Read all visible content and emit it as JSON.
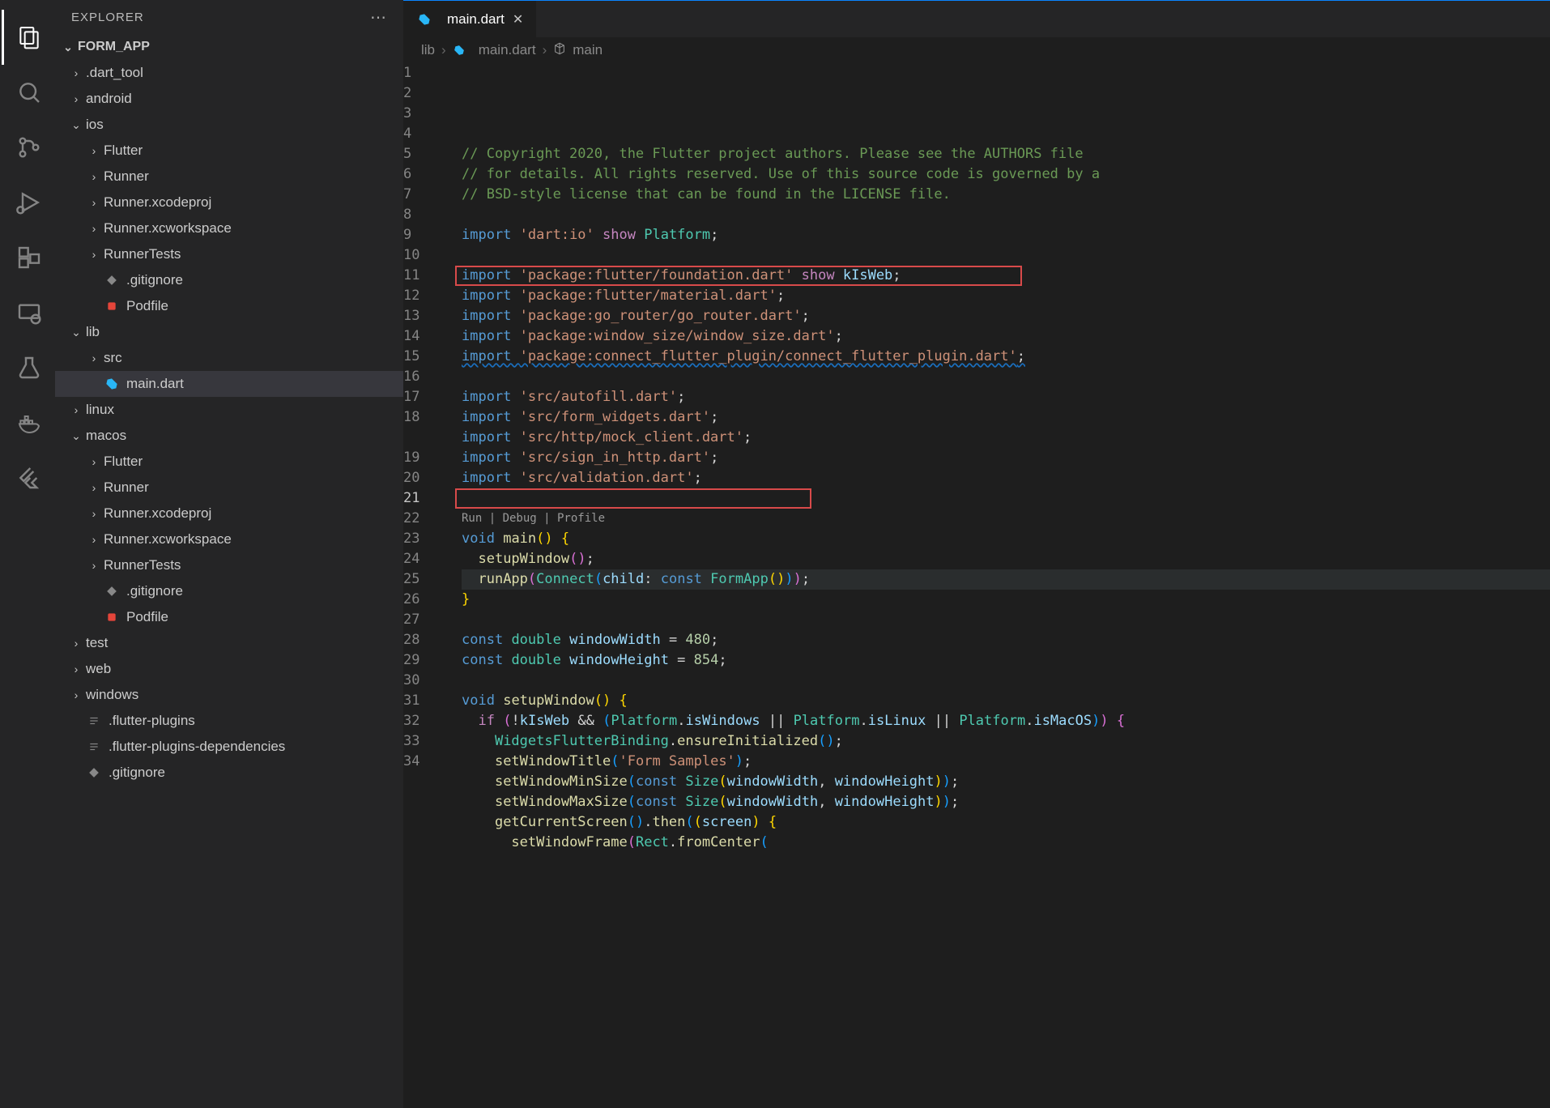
{
  "explorer_title": "EXPLORER",
  "project_name": "FORM_APP",
  "tab": {
    "label": "main.dart"
  },
  "breadcrumbs": {
    "folder": "lib",
    "file": "main.dart",
    "symbol": "main"
  },
  "codelens": "Run | Debug | Profile",
  "tree": [
    {
      "depth": 0,
      "chev": "›",
      "icon": "folder",
      "label": ".dart_tool"
    },
    {
      "depth": 0,
      "chev": "›",
      "icon": "folder",
      "label": "android"
    },
    {
      "depth": 0,
      "chev": "⌄",
      "icon": "folder",
      "label": "ios"
    },
    {
      "depth": 1,
      "chev": "›",
      "icon": "folder",
      "label": "Flutter"
    },
    {
      "depth": 1,
      "chev": "›",
      "icon": "folder",
      "label": "Runner"
    },
    {
      "depth": 1,
      "chev": "›",
      "icon": "folder",
      "label": "Runner.xcodeproj"
    },
    {
      "depth": 1,
      "chev": "›",
      "icon": "folder",
      "label": "Runner.xcworkspace"
    },
    {
      "depth": 1,
      "chev": "›",
      "icon": "folder",
      "label": "RunnerTests"
    },
    {
      "depth": 1,
      "chev": "",
      "icon": "git",
      "label": ".gitignore"
    },
    {
      "depth": 1,
      "chev": "",
      "icon": "pod",
      "label": "Podfile"
    },
    {
      "depth": 0,
      "chev": "⌄",
      "icon": "folder",
      "label": "lib"
    },
    {
      "depth": 1,
      "chev": "›",
      "icon": "folder",
      "label": "src"
    },
    {
      "depth": 1,
      "chev": "",
      "icon": "dart",
      "label": "main.dart",
      "active": true
    },
    {
      "depth": 0,
      "chev": "›",
      "icon": "folder",
      "label": "linux"
    },
    {
      "depth": 0,
      "chev": "⌄",
      "icon": "folder",
      "label": "macos"
    },
    {
      "depth": 1,
      "chev": "›",
      "icon": "folder",
      "label": "Flutter"
    },
    {
      "depth": 1,
      "chev": "›",
      "icon": "folder",
      "label": "Runner"
    },
    {
      "depth": 1,
      "chev": "›",
      "icon": "folder",
      "label": "Runner.xcodeproj"
    },
    {
      "depth": 1,
      "chev": "›",
      "icon": "folder",
      "label": "Runner.xcworkspace"
    },
    {
      "depth": 1,
      "chev": "›",
      "icon": "folder",
      "label": "RunnerTests"
    },
    {
      "depth": 1,
      "chev": "",
      "icon": "git",
      "label": ".gitignore"
    },
    {
      "depth": 1,
      "chev": "",
      "icon": "pod",
      "label": "Podfile"
    },
    {
      "depth": 0,
      "chev": "›",
      "icon": "folder",
      "label": "test"
    },
    {
      "depth": 0,
      "chev": "›",
      "icon": "folder",
      "label": "web"
    },
    {
      "depth": 0,
      "chev": "›",
      "icon": "folder",
      "label": "windows"
    },
    {
      "depth": 0,
      "chev": "",
      "icon": "text",
      "label": ".flutter-plugins"
    },
    {
      "depth": 0,
      "chev": "",
      "icon": "text",
      "label": ".flutter-plugins-dependencies"
    },
    {
      "depth": 0,
      "chev": "",
      "icon": "git",
      "label": ".gitignore"
    }
  ],
  "code": {
    "lines": [
      {
        "n": 1,
        "tokens": [
          [
            "comment",
            "// Copyright 2020, the Flutter project authors. Please see the AUTHORS file"
          ]
        ]
      },
      {
        "n": 2,
        "tokens": [
          [
            "comment",
            "// for details. All rights reserved. Use of this source code is governed by a"
          ]
        ]
      },
      {
        "n": 3,
        "tokens": [
          [
            "comment",
            "// BSD-style license that can be found in the LICENSE file."
          ]
        ]
      },
      {
        "n": 4,
        "tokens": []
      },
      {
        "n": 5,
        "tokens": [
          [
            "keyword",
            "import "
          ],
          [
            "string",
            "'dart:io'"
          ],
          [
            "punc",
            " "
          ],
          [
            "show",
            "show"
          ],
          [
            "punc",
            " "
          ],
          [
            "type",
            "Platform"
          ],
          [
            "punc",
            ";"
          ]
        ]
      },
      {
        "n": 6,
        "tokens": []
      },
      {
        "n": 7,
        "tokens": [
          [
            "keyword",
            "import "
          ],
          [
            "string",
            "'package:flutter/foundation.dart'"
          ],
          [
            "punc",
            " "
          ],
          [
            "show",
            "show"
          ],
          [
            "punc",
            " "
          ],
          [
            "ident",
            "kIsWeb"
          ],
          [
            "punc",
            ";"
          ]
        ]
      },
      {
        "n": 8,
        "tokens": [
          [
            "keyword",
            "import "
          ],
          [
            "string",
            "'package:flutter/material.dart'"
          ],
          [
            "punc",
            ";"
          ]
        ]
      },
      {
        "n": 9,
        "tokens": [
          [
            "keyword",
            "import "
          ],
          [
            "string",
            "'package:go_router/go_router.dart'"
          ],
          [
            "punc",
            ";"
          ]
        ]
      },
      {
        "n": 10,
        "tokens": [
          [
            "keyword",
            "import "
          ],
          [
            "string",
            "'package:window_size/window_size.dart'"
          ],
          [
            "punc",
            ";"
          ]
        ]
      },
      {
        "n": 11,
        "wavy": true,
        "tokens": [
          [
            "keyword",
            "import "
          ],
          [
            "string",
            "'package:connect_flutter_plugin/connect_flutter_plugin.dart'"
          ],
          [
            "punc",
            ";"
          ]
        ]
      },
      {
        "n": 12,
        "tokens": []
      },
      {
        "n": 13,
        "tokens": [
          [
            "keyword",
            "import "
          ],
          [
            "string",
            "'src/autofill.dart'"
          ],
          [
            "punc",
            ";"
          ]
        ]
      },
      {
        "n": 14,
        "tokens": [
          [
            "keyword",
            "import "
          ],
          [
            "string",
            "'src/form_widgets.dart'"
          ],
          [
            "punc",
            ";"
          ]
        ]
      },
      {
        "n": 15,
        "tokens": [
          [
            "keyword",
            "import "
          ],
          [
            "string",
            "'src/http/mock_client.dart'"
          ],
          [
            "punc",
            ";"
          ]
        ]
      },
      {
        "n": 16,
        "tokens": [
          [
            "keyword",
            "import "
          ],
          [
            "string",
            "'src/sign_in_http.dart'"
          ],
          [
            "punc",
            ";"
          ]
        ]
      },
      {
        "n": 17,
        "tokens": [
          [
            "keyword",
            "import "
          ],
          [
            "string",
            "'src/validation.dart'"
          ],
          [
            "punc",
            ";"
          ]
        ]
      },
      {
        "n": 18,
        "tokens": []
      },
      {
        "codelens": true
      },
      {
        "n": 19,
        "tokens": [
          [
            "const",
            "void"
          ],
          [
            "punc",
            " "
          ],
          [
            "func",
            "main"
          ],
          [
            "bracket1",
            "()"
          ],
          [
            "punc",
            " "
          ],
          [
            "bracket1",
            "{"
          ]
        ]
      },
      {
        "n": 20,
        "tokens": [
          [
            "punc",
            "  "
          ],
          [
            "func",
            "setupWindow"
          ],
          [
            "bracket2",
            "()"
          ],
          [
            "punc",
            ";"
          ]
        ]
      },
      {
        "n": 21,
        "active": true,
        "tokens": [
          [
            "punc",
            "  "
          ],
          [
            "func",
            "runApp"
          ],
          [
            "bracket2",
            "("
          ],
          [
            "type",
            "Connect"
          ],
          [
            "bracket3",
            "("
          ],
          [
            "param",
            "child"
          ],
          [
            "punc",
            ": "
          ],
          [
            "const",
            "const"
          ],
          [
            "punc",
            " "
          ],
          [
            "type",
            "FormApp"
          ],
          [
            "bracket1",
            "()"
          ],
          [
            "bracket3",
            ")"
          ],
          [
            "bracket2",
            ")"
          ],
          [
            "punc",
            ";"
          ]
        ]
      },
      {
        "n": 22,
        "tokens": [
          [
            "bracket1",
            "}"
          ]
        ]
      },
      {
        "n": 23,
        "tokens": []
      },
      {
        "n": 24,
        "tokens": [
          [
            "const",
            "const"
          ],
          [
            "punc",
            " "
          ],
          [
            "type",
            "double"
          ],
          [
            "punc",
            " "
          ],
          [
            "ident",
            "windowWidth"
          ],
          [
            "punc",
            " = "
          ],
          [
            "num",
            "480"
          ],
          [
            "punc",
            ";"
          ]
        ]
      },
      {
        "n": 25,
        "tokens": [
          [
            "const",
            "const"
          ],
          [
            "punc",
            " "
          ],
          [
            "type",
            "double"
          ],
          [
            "punc",
            " "
          ],
          [
            "ident",
            "windowHeight"
          ],
          [
            "punc",
            " = "
          ],
          [
            "num",
            "854"
          ],
          [
            "punc",
            ";"
          ]
        ]
      },
      {
        "n": 26,
        "tokens": []
      },
      {
        "n": 27,
        "tokens": [
          [
            "const",
            "void"
          ],
          [
            "punc",
            " "
          ],
          [
            "func",
            "setupWindow"
          ],
          [
            "bracket1",
            "()"
          ],
          [
            "punc",
            " "
          ],
          [
            "bracket1",
            "{"
          ]
        ]
      },
      {
        "n": 28,
        "tokens": [
          [
            "punc",
            "  "
          ],
          [
            "show",
            "if"
          ],
          [
            "punc",
            " "
          ],
          [
            "bracket2",
            "("
          ],
          [
            "punc",
            "!"
          ],
          [
            "ident",
            "kIsWeb"
          ],
          [
            "punc",
            " && "
          ],
          [
            "bracket3",
            "("
          ],
          [
            "type",
            "Platform"
          ],
          [
            "punc",
            "."
          ],
          [
            "ident",
            "isWindows"
          ],
          [
            "punc",
            " || "
          ],
          [
            "type",
            "Platform"
          ],
          [
            "punc",
            "."
          ],
          [
            "ident",
            "isLinux"
          ],
          [
            "punc",
            " || "
          ],
          [
            "type",
            "Platform"
          ],
          [
            "punc",
            "."
          ],
          [
            "ident",
            "isMacOS"
          ],
          [
            "bracket3",
            ")"
          ],
          [
            "bracket2",
            ")"
          ],
          [
            "punc",
            " "
          ],
          [
            "bracket2",
            "{"
          ]
        ]
      },
      {
        "n": 29,
        "tokens": [
          [
            "punc",
            "    "
          ],
          [
            "type",
            "WidgetsFlutterBinding"
          ],
          [
            "punc",
            "."
          ],
          [
            "func",
            "ensureInitialized"
          ],
          [
            "bracket3",
            "()"
          ],
          [
            "punc",
            ";"
          ]
        ]
      },
      {
        "n": 30,
        "tokens": [
          [
            "punc",
            "    "
          ],
          [
            "func",
            "setWindowTitle"
          ],
          [
            "bracket3",
            "("
          ],
          [
            "string",
            "'Form Samples'"
          ],
          [
            "bracket3",
            ")"
          ],
          [
            "punc",
            ";"
          ]
        ]
      },
      {
        "n": 31,
        "tokens": [
          [
            "punc",
            "    "
          ],
          [
            "func",
            "setWindowMinSize"
          ],
          [
            "bracket3",
            "("
          ],
          [
            "const",
            "const"
          ],
          [
            "punc",
            " "
          ],
          [
            "type",
            "Size"
          ],
          [
            "bracket1",
            "("
          ],
          [
            "ident",
            "windowWidth"
          ],
          [
            "punc",
            ", "
          ],
          [
            "ident",
            "windowHeight"
          ],
          [
            "bracket1",
            ")"
          ],
          [
            "bracket3",
            ")"
          ],
          [
            "punc",
            ";"
          ]
        ]
      },
      {
        "n": 32,
        "tokens": [
          [
            "punc",
            "    "
          ],
          [
            "func",
            "setWindowMaxSize"
          ],
          [
            "bracket3",
            "("
          ],
          [
            "const",
            "const"
          ],
          [
            "punc",
            " "
          ],
          [
            "type",
            "Size"
          ],
          [
            "bracket1",
            "("
          ],
          [
            "ident",
            "windowWidth"
          ],
          [
            "punc",
            ", "
          ],
          [
            "ident",
            "windowHeight"
          ],
          [
            "bracket1",
            ")"
          ],
          [
            "bracket3",
            ")"
          ],
          [
            "punc",
            ";"
          ]
        ]
      },
      {
        "n": 33,
        "tokens": [
          [
            "punc",
            "    "
          ],
          [
            "func",
            "getCurrentScreen"
          ],
          [
            "bracket3",
            "()"
          ],
          [
            "punc",
            "."
          ],
          [
            "func",
            "then"
          ],
          [
            "bracket3",
            "("
          ],
          [
            "bracket1",
            "("
          ],
          [
            "ident",
            "screen"
          ],
          [
            "bracket1",
            ")"
          ],
          [
            "punc",
            " "
          ],
          [
            "bracket1",
            "{"
          ]
        ]
      },
      {
        "n": 34,
        "tokens": [
          [
            "punc",
            "      "
          ],
          [
            "func",
            "setWindowFrame"
          ],
          [
            "bracket2",
            "("
          ],
          [
            "type",
            "Rect"
          ],
          [
            "punc",
            "."
          ],
          [
            "func",
            "fromCenter"
          ],
          [
            "bracket3",
            "("
          ]
        ]
      }
    ]
  }
}
